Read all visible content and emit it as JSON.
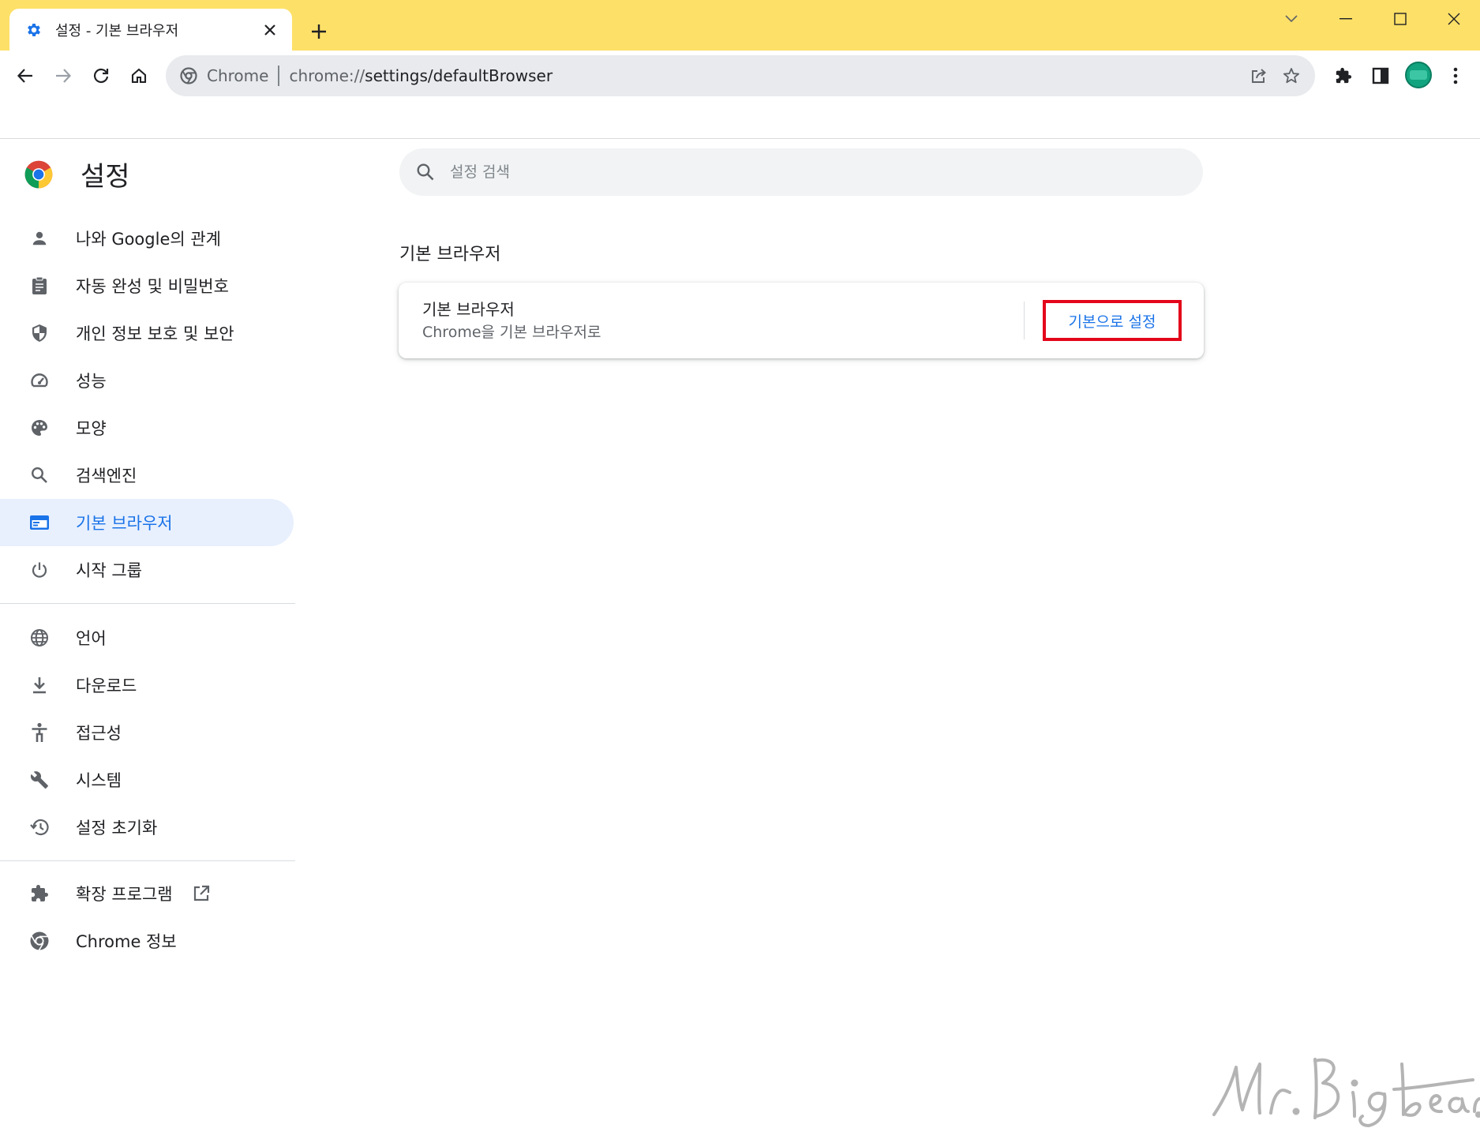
{
  "window": {
    "tab_title": "설정 - 기본 브라우저",
    "tab_favicon": "gear-icon",
    "colors": {
      "tabstrip": "#fde068",
      "accent": "#1a73e8",
      "highlight_box": "#e3061b"
    }
  },
  "toolbar": {
    "omnibox_chip": "Chrome",
    "url_scheme": "chrome://",
    "url_path": "settings/defaultBrowser"
  },
  "sidebar": {
    "title": "설정",
    "groups": [
      [
        {
          "label": "나와 Google의 관계",
          "icon": "person-icon"
        },
        {
          "label": "자동 완성 및 비밀번호",
          "icon": "clipboard-icon"
        },
        {
          "label": "개인 정보 보호 및 보안",
          "icon": "shield-icon"
        },
        {
          "label": "성능",
          "icon": "speedometer-icon"
        },
        {
          "label": "모양",
          "icon": "palette-icon"
        },
        {
          "label": "검색엔진",
          "icon": "search-icon"
        },
        {
          "label": "기본 브라우저",
          "icon": "browser-window-icon",
          "active": true
        },
        {
          "label": "시작 그룹",
          "icon": "power-icon"
        }
      ],
      [
        {
          "label": "언어",
          "icon": "globe-icon"
        },
        {
          "label": "다운로드",
          "icon": "download-icon"
        },
        {
          "label": "접근성",
          "icon": "accessibility-icon"
        },
        {
          "label": "시스템",
          "icon": "wrench-icon"
        },
        {
          "label": "설정 초기화",
          "icon": "history-reset-icon"
        }
      ],
      [
        {
          "label": "확장 프로그램",
          "icon": "puzzle-icon",
          "external": true
        },
        {
          "label": "Chrome 정보",
          "icon": "chrome-icon"
        }
      ]
    ]
  },
  "main": {
    "search_placeholder": "설정 검색",
    "section_title": "기본 브라우저",
    "card": {
      "title": "기본 브라우저",
      "subtitle": "Chrome을 기본 브라우저로",
      "button": "기본으로 설정"
    }
  },
  "watermark": "Mr. Big bear."
}
